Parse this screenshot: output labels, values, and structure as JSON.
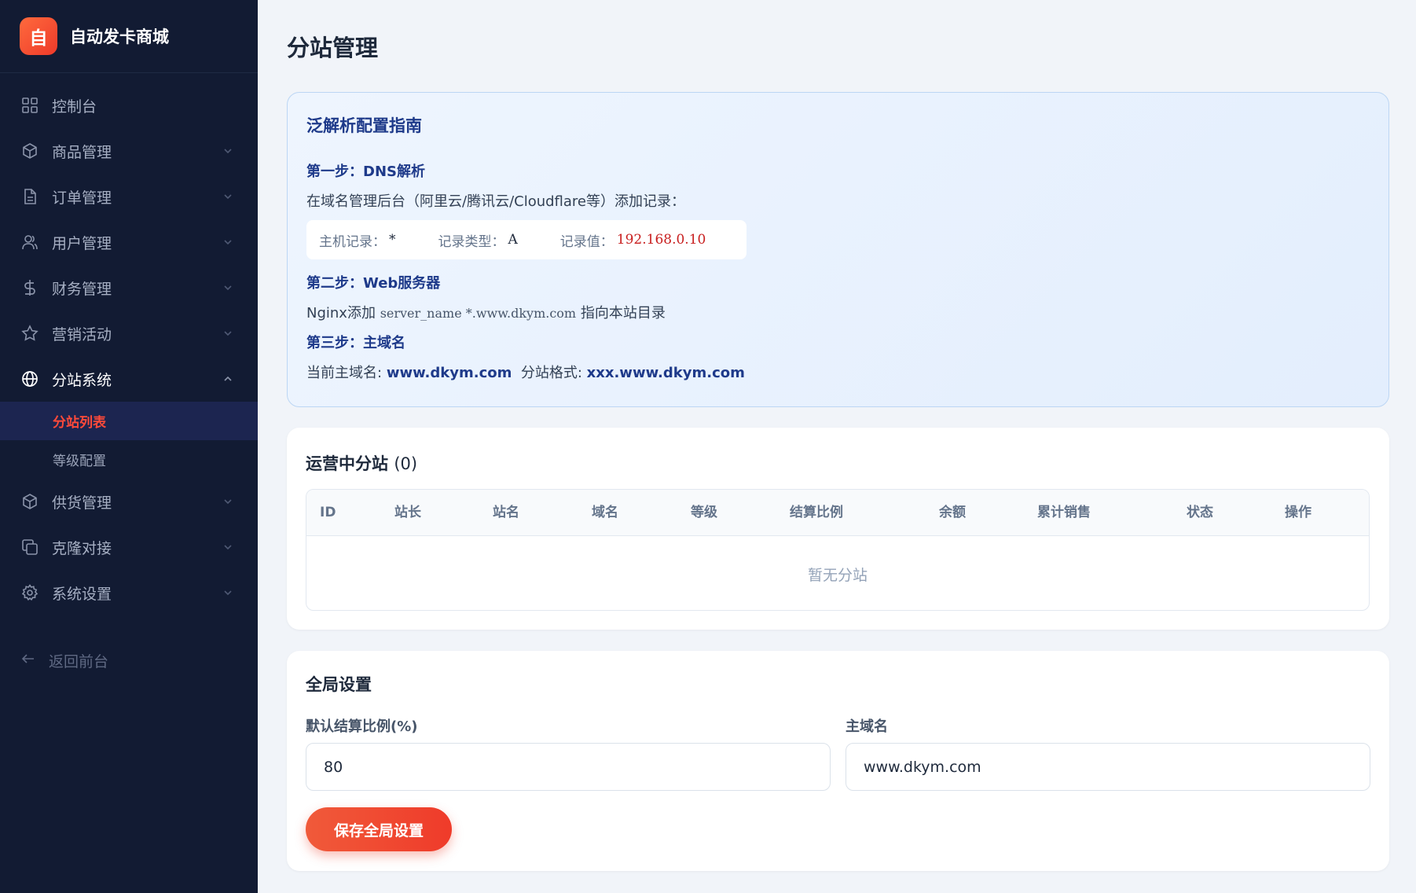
{
  "app": {
    "logo_text": "自",
    "name": "自动发卡商城"
  },
  "sidebar": {
    "items": [
      {
        "label": "控制台",
        "icon": "dashboard-icon"
      },
      {
        "label": "商品管理",
        "icon": "box-icon"
      },
      {
        "label": "订单管理",
        "icon": "document-icon"
      },
      {
        "label": "用户管理",
        "icon": "users-icon"
      },
      {
        "label": "财务管理",
        "icon": "dollar-icon"
      },
      {
        "label": "营销活动",
        "icon": "star-icon"
      },
      {
        "label": "分站系统",
        "icon": "globe-icon"
      },
      {
        "label": "供货管理",
        "icon": "box-icon"
      },
      {
        "label": "克隆对接",
        "icon": "copy-icon"
      },
      {
        "label": "系统设置",
        "icon": "gear-icon"
      }
    ],
    "subitems": [
      {
        "label": "分站列表",
        "active": true
      },
      {
        "label": "等级配置",
        "active": false
      }
    ],
    "back_label": "返回前台"
  },
  "page": {
    "title": "分站管理"
  },
  "guide": {
    "title": "泛解析配置指南",
    "step1_title": "第一步：DNS解析",
    "step1_desc": "在域名管理后台（阿里云/腾讯云/Cloudflare等）添加记录：",
    "record": {
      "host_label": "主机记录：",
      "host_value": "*",
      "type_label": "记录类型：",
      "type_value": "A",
      "value_label": "记录值：",
      "value_value": "192.168.0.10"
    },
    "step2_title": "第二步：Web服务器",
    "step2_prefix": "Nginx添加",
    "step2_code": "server_name *.www.dkym.com",
    "step2_suffix": "指向本站目录",
    "step3_title": "第三步：主域名",
    "step3_main_label": "当前主域名:",
    "step3_main_value": "www.dkym.com",
    "step3_sub_label": "分站格式:",
    "step3_sub_value": "xxx.www.dkym.com"
  },
  "stations": {
    "title": "运营中分站",
    "count": "(0)",
    "columns": [
      "ID",
      "站长",
      "站名",
      "域名",
      "等级",
      "结算比例",
      "余额",
      "累计销售",
      "状态",
      "操作"
    ],
    "empty_text": "暂无分站"
  },
  "settings": {
    "title": "全局设置",
    "ratio_label": "默认结算比例(%)",
    "ratio_value": "80",
    "domain_label": "主域名",
    "domain_value": "www.dkym.com",
    "save_label": "保存全局设置"
  },
  "colors": {
    "accent": "#ef4a30",
    "sidebar_bg": "#121b33",
    "active_text": "#ff4a3a",
    "guide_heading": "#1e3a8a"
  }
}
